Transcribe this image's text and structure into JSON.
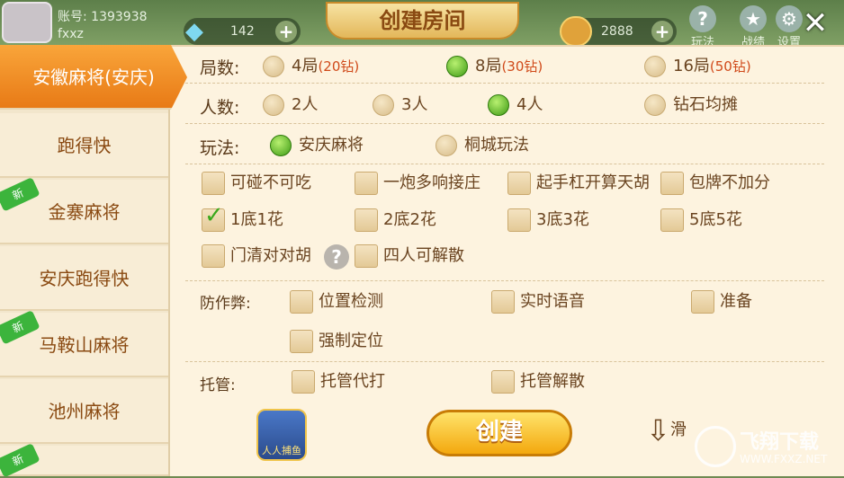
{
  "account": {
    "id_label": "账号: 1393938",
    "name": "fxxz"
  },
  "resources": {
    "diamonds": "142",
    "coins": "2888"
  },
  "title": "创建房间",
  "top_buttons": {
    "rules": "玩法",
    "record": "战绩",
    "settings": "设置"
  },
  "sidebar": {
    "items": [
      {
        "label": "安徽麻将(安庆)",
        "active": true,
        "new": false
      },
      {
        "label": "跑得快",
        "active": false,
        "new": false
      },
      {
        "label": "金寨麻将",
        "active": false,
        "new": true
      },
      {
        "label": "安庆跑得快",
        "active": false,
        "new": false
      },
      {
        "label": "马鞍山麻将",
        "active": false,
        "new": true
      },
      {
        "label": "池州麻将",
        "active": false,
        "new": false
      },
      {
        "label": "",
        "active": false,
        "new": true
      }
    ],
    "new_badge": "新"
  },
  "rounds": {
    "label": "局数:",
    "options": [
      {
        "text": "4局",
        "cost": "(20钻)",
        "selected": false
      },
      {
        "text": "8局",
        "cost": "(30钻)",
        "selected": true
      },
      {
        "text": "16局",
        "cost": "(50钻)",
        "selected": false
      }
    ]
  },
  "players": {
    "label": "人数:",
    "options": [
      {
        "text": "2人",
        "selected": false
      },
      {
        "text": "3人",
        "selected": false
      },
      {
        "text": "4人",
        "selected": true
      },
      {
        "text": "钻石均摊",
        "selected": false
      }
    ]
  },
  "mode": {
    "label": "玩法:",
    "options": [
      {
        "text": "安庆麻将",
        "selected": true
      },
      {
        "text": "桐城玩法",
        "selected": false
      }
    ]
  },
  "rules": [
    {
      "text": "可碰不可吃",
      "checked": false
    },
    {
      "text": "一炮多响接庄",
      "checked": false
    },
    {
      "text": "起手杠开算天胡",
      "checked": false
    },
    {
      "text": "包牌不加分",
      "checked": false
    },
    {
      "text": "1底1花",
      "checked": true
    },
    {
      "text": "2底2花",
      "checked": false
    },
    {
      "text": "3底3花",
      "checked": false
    },
    {
      "text": "5底5花",
      "checked": false
    },
    {
      "text": "门清对对胡",
      "checked": false
    },
    {
      "text": "四人可解散",
      "checked": false
    }
  ],
  "anticheat": {
    "label": "防作弊:",
    "options": [
      {
        "text": "位置检测",
        "checked": false
      },
      {
        "text": "实时语音",
        "checked": false
      },
      {
        "text": "准备",
        "checked": false
      },
      {
        "text": "强制定位",
        "checked": false
      }
    ]
  },
  "trustee": {
    "label": "托管:",
    "options": [
      {
        "text": "托管代打",
        "checked": false
      },
      {
        "text": "托管解散",
        "checked": false
      }
    ]
  },
  "help_icon": "?",
  "create_label": "创建",
  "fish_label": "人人捕鱼",
  "slide_hint": "滑",
  "watermark": {
    "title": "飞翔下载",
    "url": "WWW.FXXZ.NET"
  }
}
